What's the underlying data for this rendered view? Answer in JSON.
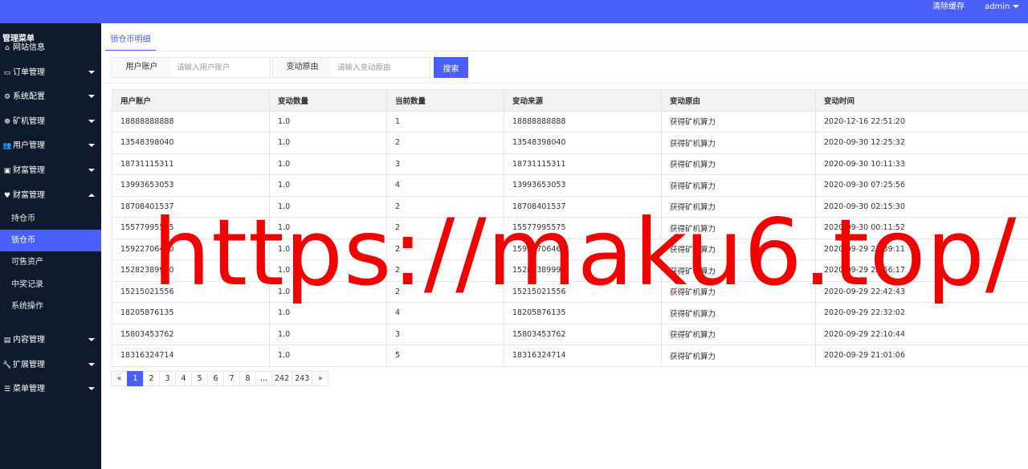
{
  "topbar": {
    "clear_cache": "清除缓存",
    "user": "admin",
    "bg_color": "#4a5ff6"
  },
  "sidebar": {
    "header": "管理菜单",
    "items": [
      {
        "label": "网站信息",
        "icon": "home-icon",
        "glyph": "⌂",
        "arrow": ""
      },
      {
        "label": "订单管理",
        "icon": "card-icon",
        "glyph": "▭",
        "arrow": "down"
      },
      {
        "label": "系统配置",
        "icon": "gears-icon",
        "glyph": "⚙",
        "arrow": "down"
      },
      {
        "label": "矿机管理",
        "icon": "helm-icon",
        "glyph": "☸",
        "arrow": "down"
      },
      {
        "label": "用户管理",
        "icon": "users-icon",
        "glyph": "👥",
        "arrow": "down"
      },
      {
        "label": "财富管理",
        "icon": "money-icon",
        "glyph": "▣",
        "arrow": "down"
      },
      {
        "label": "财富管理",
        "icon": "heart-icon",
        "glyph": "♥",
        "arrow": "up"
      }
    ],
    "sub_items": [
      "持仓币",
      "锁仓币",
      "可售资产",
      "中奖记录",
      "系统操作"
    ],
    "bottom_items": [
      {
        "label": "内容管理",
        "icon": "file-icon",
        "glyph": "▤"
      },
      {
        "label": "扩展管理",
        "icon": "wrench-icon",
        "glyph": "🔧"
      },
      {
        "label": "菜单管理",
        "icon": "list-icon",
        "glyph": "☰"
      }
    ]
  },
  "tab": {
    "label": "锁仓币明细"
  },
  "filters": {
    "user_label": "用户账户",
    "user_placeholder": "请输入用户账户",
    "reason_label": "变动原由",
    "reason_placeholder": "请输入变动原由",
    "search_label": "搜索"
  },
  "table": {
    "columns": [
      "用户账户",
      "变动数量",
      "当前数量",
      "变动来源",
      "变动原由",
      "变动时间"
    ],
    "rows": [
      [
        "18888888888",
        "1.0",
        "1",
        "18888888888",
        "获得矿机算力",
        "2020-12-16 22:51:20"
      ],
      [
        "13548398040",
        "1.0",
        "2",
        "13548398040",
        "获得矿机算力",
        "2020-09-30 12:25:32"
      ],
      [
        "18731115311",
        "1.0",
        "3",
        "18731115311",
        "获得矿机算力",
        "2020-09-30 10:11:33"
      ],
      [
        "13993653053",
        "1.0",
        "4",
        "13993653053",
        "获得矿机算力",
        "2020-09-30 07:25:56"
      ],
      [
        "18708401537",
        "1.0",
        "2",
        "18708401537",
        "获得矿机算力",
        "2020-09-30 02:15:30"
      ],
      [
        "15577995575",
        "1.0",
        "2",
        "15577995575",
        "获得矿机算力",
        "2020-09-30 00:11:52"
      ],
      [
        "15922706460",
        "1.0",
        "2",
        "15922706460",
        "获得矿机算力",
        "2020-09-29 23:39:11"
      ],
      [
        "15282389990",
        "1.0",
        "2",
        "15282389990",
        "获得矿机算力",
        "2020-09-29 22:56:17"
      ],
      [
        "15215021556",
        "1.0",
        "2",
        "15215021556",
        "获得矿机算力",
        "2020-09-29 22:42:43"
      ],
      [
        "18205876135",
        "1.0",
        "4",
        "18205876135",
        "获得矿机算力",
        "2020-09-29 22:32:02"
      ],
      [
        "15803453762",
        "1.0",
        "3",
        "15803453762",
        "获得矿机算力",
        "2020-09-29 22:10:44"
      ],
      [
        "18316324714",
        "1.0",
        "5",
        "18316324714",
        "获得矿机算力",
        "2020-09-29 21:01:06"
      ]
    ]
  },
  "pagination": [
    "«",
    "1",
    "2",
    "3",
    "4",
    "5",
    "6",
    "7",
    "8",
    "...",
    "242",
    "243",
    "»"
  ],
  "pagination_current": "1",
  "watermark": "https://maku6.top/"
}
